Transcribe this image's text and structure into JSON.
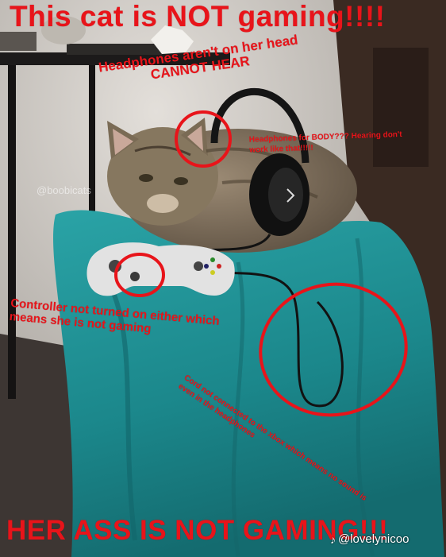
{
  "title": "This cat is NOT gaming!!!!",
  "annotations": {
    "head": "Headphones aren't on her head CANNOT HEAR",
    "body": "Headphones for BODY??? Hearing don't work like that!!!!!",
    "controller": "Controller not turned on either which means she is not gaming",
    "cord": "Cord not connected to the xbox which means no sound is even in the headphones"
  },
  "bottom_text": "HER ASS IS NOT GAMING!!!",
  "watermark": "@boobicats",
  "tiktok_handle": "@lovelynicoo",
  "icons": {
    "tiktok": "tiktok-icon"
  },
  "colors": {
    "annotation": "#e8141a",
    "blanket": "#1f8f93",
    "wall": "#cfcac4"
  }
}
